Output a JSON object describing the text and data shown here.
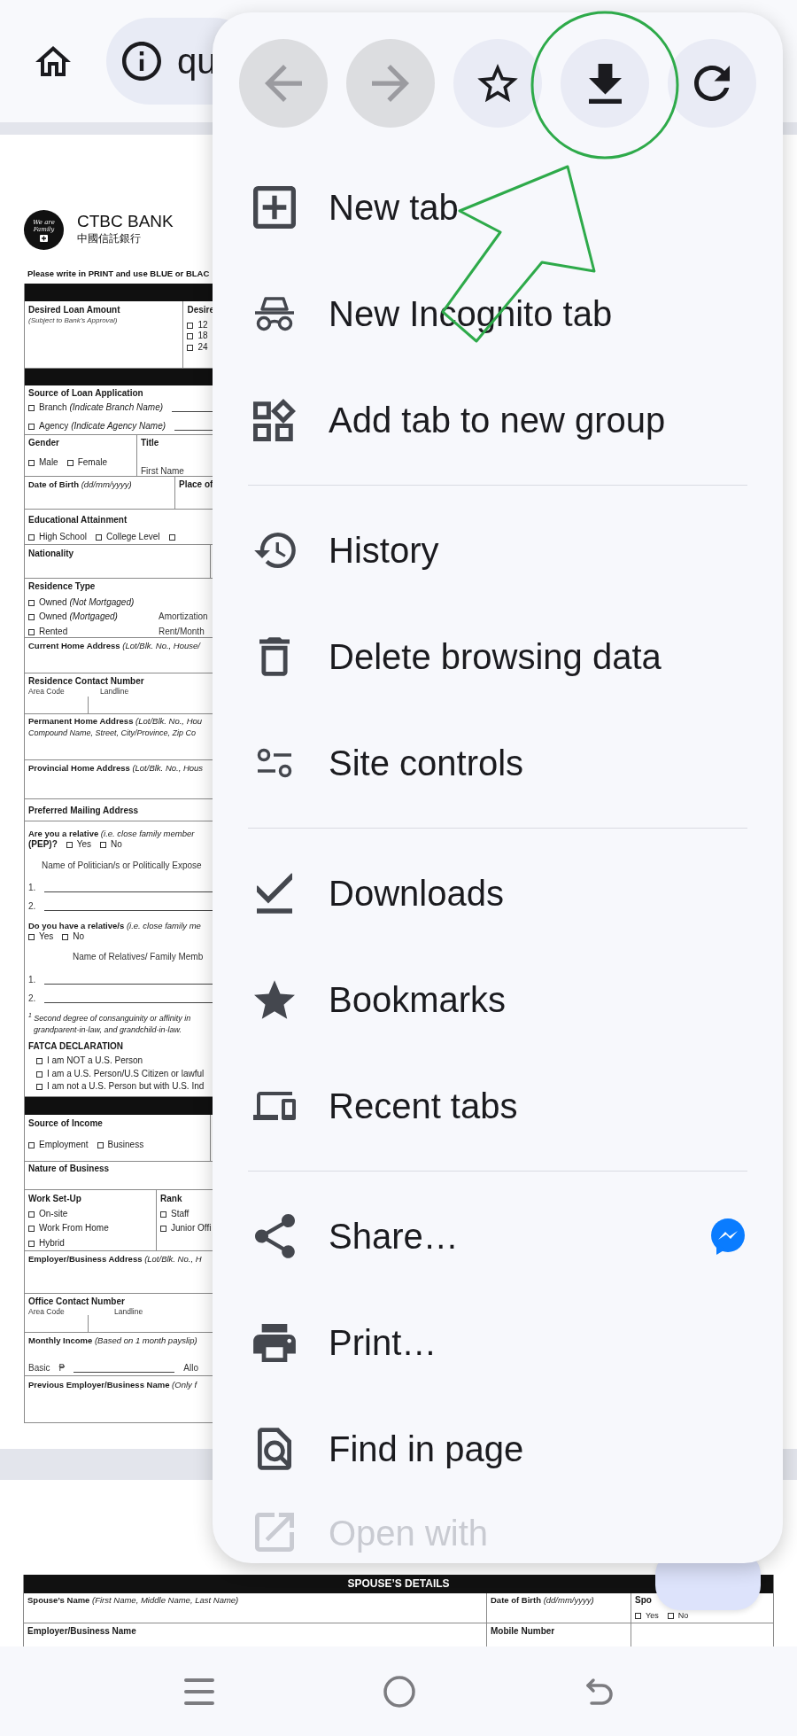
{
  "top_bar": {
    "url": "qu"
  },
  "document": {
    "logo_text": "We are Family",
    "bank_name": "CTBC BANK",
    "bank_name_chinese": "中國信託銀行",
    "instruction": "Please write in PRINT and use BLUE or BLAC",
    "form_rows": [
      {
        "kind": "bar"
      },
      {
        "kind": "row",
        "cells": [
          {
            "lines": [
              [
                {
                  "kind": "label",
                  "text": "Desired Loan Amount"
                }
              ],
              [
                {
                  "kind": "fine",
                  "text": "(Subject to Bank’s Approval)"
                }
              ]
            ]
          },
          {
            "lines": [
              [
                {
                  "kind": "label",
                  "text": "Desire"
                }
              ],
              [
                {
                  "kind": "check",
                  "text": "12",
                  "checked": false
                }
              ],
              [
                {
                  "kind": "check",
                  "text": "18",
                  "checked": false
                }
              ],
              [
                {
                  "kind": "check",
                  "text": "24",
                  "checked": false
                }
              ]
            ]
          }
        ]
      },
      {
        "kind": "bar"
      },
      {
        "kind": "row",
        "cells": [
          {
            "lines": [
              [
                {
                  "kind": "label",
                  "text": "Source of Loan Application"
                }
              ],
              [
                {
                  "kind": "check",
                  "text": "Branch *(Indicate Branch Name)*",
                  "checked": false
                },
                {
                  "kind": "blank"
                }
              ],
              [
                {
                  "kind": "check",
                  "text": "Agency *(Indicate Agency Name)*",
                  "checked": false
                },
                {
                  "kind": "blank"
                }
              ]
            ]
          }
        ]
      },
      {
        "kind": "row",
        "cells": [
          {
            "lines": [
              [
                {
                  "kind": "label",
                  "text": "Gender"
                }
              ],
              [
                {
                  "kind": "check",
                  "text": "Male",
                  "checked": false
                },
                {
                  "kind": "check",
                  "text": "Female",
                  "checked": false
                }
              ]
            ]
          },
          {
            "lines": [
              [
                {
                  "kind": "label",
                  "text": "Title"
                }
              ],
              [
                {
                  "kind": "text",
                  "text": "First Name"
                }
              ]
            ]
          }
        ]
      },
      {
        "kind": "row",
        "cells": [
          {
            "lines": [
              [
                {
                  "kind": "mixed",
                  "text": "**Date of Birth** *(dd/mm/yyyy)*"
                }
              ]
            ]
          },
          {
            "lines": [
              [
                {
                  "kind": "label",
                  "text": "Place of"
                }
              ]
            ]
          }
        ]
      },
      {
        "kind": "row",
        "cells": [
          {
            "lines": [
              [
                {
                  "kind": "label",
                  "text": "Educational Attainment"
                }
              ],
              [
                {
                  "kind": "check",
                  "text": "High School",
                  "checked": false
                },
                {
                  "kind": "check",
                  "text": "College Level",
                  "checked": false
                },
                {
                  "kind": "check",
                  "checked": false
                }
              ]
            ]
          }
        ]
      },
      {
        "kind": "row",
        "cells": [
          {
            "lines": [
              [
                {
                  "kind": "label",
                  "text": "Nationality"
                }
              ]
            ]
          },
          {}
        ]
      },
      {
        "kind": "row",
        "cells": [
          {
            "lines": [
              [
                {
                  "kind": "label",
                  "text": "Residence Type"
                }
              ],
              [
                {
                  "kind": "check",
                  "text": "Owned *(Not Mortgaged)*",
                  "checked": false
                }
              ],
              [
                {
                  "kind": "check",
                  "text": "Owned *(Mortgaged)*",
                  "checked": false
                },
                {
                  "kind": "aside",
                  "text": "Amortization"
                }
              ],
              [
                {
                  "kind": "check",
                  "text": "Rented",
                  "checked": false
                },
                {
                  "kind": "aside",
                  "text": "Rent/Month"
                }
              ]
            ]
          }
        ]
      },
      {
        "kind": "row",
        "cells": [
          {
            "lines": [
              [
                {
                  "kind": "mixed",
                  "text": "**Current Home Address** *(Lot/Blk. No., House/*"
                }
              ]
            ]
          }
        ]
      },
      {
        "kind": "row",
        "cells": [
          {
            "lines": [
              [
                {
                  "kind": "label",
                  "text": "Residence Contact Number"
                }
              ],
              [
                {
                  "kind": "sub",
                  "text": "Area Code"
                },
                {
                  "kind": "sub",
                  "text": "Landline"
                }
              ]
            ]
          }
        ]
      },
      {
        "kind": "row",
        "cells": [
          {
            "lines": [
              [
                {
                  "kind": "mixed",
                  "text": "**Permanent Home Address** *(Lot/Blk. No., Hou*"
                }
              ],
              [
                {
                  "kind": "note",
                  "text": "Compound Name, Street, City/Province, Zip Co"
                }
              ]
            ]
          }
        ]
      },
      {
        "kind": "row",
        "cells": [
          {
            "lines": [
              [
                {
                  "kind": "mixed",
                  "text": "**Provincial Home Address** *(Lot/Blk. No., Hous*"
                }
              ]
            ]
          }
        ]
      },
      {
        "kind": "row",
        "cells": [
          {
            "lines": [
              [
                {
                  "kind": "label",
                  "text": "Preferred Mailing Address"
                }
              ]
            ]
          }
        ]
      },
      {
        "kind": "row",
        "cells": [
          {
            "lines": [
              [
                {
                  "kind": "mixed",
                  "text": "**Are you a relative** *(i.e. close family member*"
                }
              ],
              [
                {
                  "kind": "label",
                  "text": "(PEP)?"
                },
                {
                  "kind": "check",
                  "text": "Yes",
                  "checked": false
                },
                {
                  "kind": "check",
                  "text": "No",
                  "checked": false
                }
              ],
              [
                {
                  "kind": "text",
                  "text": "Name of Politician/s or Politically Expose"
                }
              ],
              [
                {
                  "kind": "text",
                  "text": "1."
                },
                {
                  "kind": "blank"
                }
              ],
              [
                {
                  "kind": "text",
                  "text": "2."
                },
                {
                  "kind": "blank"
                }
              ],
              [
                {
                  "kind": "mixed",
                  "text": "**Do you have a relative/s** *(i.e. close family me*"
                }
              ],
              [
                {
                  "kind": "check",
                  "text": "Yes",
                  "checked": false
                },
                {
                  "kind": "check",
                  "text": "No",
                  "checked": false
                }
              ],
              [
                {
                  "kind": "text",
                  "text": "Name of Relatives/ Family Memb"
                }
              ],
              [
                {
                  "kind": "text",
                  "text": "1."
                },
                {
                  "kind": "blank"
                }
              ],
              [
                {
                  "kind": "text",
                  "text": "2."
                },
                {
                  "kind": "blank"
                }
              ],
              [
                {
                  "kind": "note",
                  "text": "$^{1}$ Second degree of consanguinity or affinity in"
                }
              ],
              [
                {
                  "kind": "note",
                  "text": "grandparent-in-law, and grandchild-in-law."
                }
              ],
              [
                {
                  "kind": "label",
                  "text": "FATCA DECLARATION"
                }
              ],
              [
                {
                  "kind": "check",
                  "text": "I am NOT a U.S. Person",
                  "checked": false
                }
              ],
              [
                {
                  "kind": "check",
                  "text": "I am a U.S. Person/U.S Citizen or lawful",
                  "checked": false
                }
              ],
              [
                {
                  "kind": "check",
                  "text": "I am not a U.S. Person but with U.S. Ind",
                  "checked": false
                }
              ]
            ]
          }
        ]
      },
      {
        "kind": "bar"
      },
      {
        "kind": "row",
        "cells": [
          {
            "lines": [
              [
                {
                  "kind": "label",
                  "text": "Source of Income"
                }
              ],
              [
                {
                  "kind": "check",
                  "text": "Employment",
                  "checked": false
                },
                {
                  "kind": "check",
                  "text": "Business",
                  "checked": false
                }
              ]
            ]
          },
          {}
        ]
      },
      {
        "kind": "row",
        "cells": [
          {
            "lines": [
              [
                {
                  "kind": "label",
                  "text": "Nature of Business"
                }
              ]
            ]
          }
        ]
      },
      {
        "kind": "row",
        "cells": [
          {
            "lines": [
              [
                {
                  "kind": "label",
                  "text": "Work Set-Up"
                }
              ],
              [
                {
                  "kind": "check",
                  "text": "On-site",
                  "checked": false
                }
              ],
              [
                {
                  "kind": "check",
                  "text": "Work From Home",
                  "checked": false
                }
              ],
              [
                {
                  "kind": "check",
                  "text": "Hybrid",
                  "checked": false
                }
              ]
            ]
          },
          {
            "lines": [
              [
                {
                  "kind": "label",
                  "text": "Rank"
                }
              ],
              [
                {
                  "kind": "check",
                  "text": "Staff",
                  "checked": false
                }
              ],
              [
                {
                  "kind": "check",
                  "text": "Junior Offi",
                  "checked": false
                }
              ]
            ]
          }
        ]
      },
      {
        "kind": "row",
        "cells": [
          {
            "lines": [
              [
                {
                  "kind": "mixed",
                  "text": "**Employer/Business Address** *(Lot/Blk. No., H*"
                }
              ]
            ]
          }
        ]
      },
      {
        "kind": "row",
        "cells": [
          {
            "lines": [
              [
                {
                  "kind": "label",
                  "text": "Office Contact Number"
                }
              ],
              [
                {
                  "kind": "sub",
                  "text": "Area Code"
                },
                {
                  "kind": "sub",
                  "text": "Landline"
                }
              ]
            ]
          }
        ]
      },
      {
        "kind": "row",
        "cells": [
          {
            "lines": [
              [
                {
                  "kind": "mixed",
                  "text": "**Monthly Income** *(Based on 1 month payslip)*"
                }
              ],
              [
                {
                  "kind": "text",
                  "text": "Basic"
                },
                {
                  "kind": "text",
                  "text": "₱"
                },
                {
                  "kind": "blank"
                },
                {
                  "kind": "text",
                  "text": "Allo"
                }
              ]
            ]
          }
        ]
      },
      {
        "kind": "row",
        "cells": [
          {
            "lines": [
              [
                {
                  "kind": "mixed",
                  "text": "**Previous Employer/Business Name** *(Only f*"
                }
              ]
            ]
          }
        ]
      }
    ],
    "spouse_table": {
      "title": "SPOUSE’S DETAILS",
      "rows": [
        {
          "kind": "row",
          "cells": [
            {
              "lines": [
                [
                  {
                    "kind": "mixed",
                    "text": "**Spouse’s Name** *(First Name, Middle Name, Last Name)*"
                  }
                ]
              ]
            },
            {
              "lines": [
                [
                  {
                    "kind": "mixed",
                    "text": "**Date of Birth** *(dd/mm/yyyy)*"
                  }
                ]
              ]
            },
            {
              "lines": [
                [
                  {
                    "kind": "label",
                    "text": "Spo"
                  }
                ],
                [
                  {
                    "kind": "check",
                    "text": "Yes",
                    "checked": false
                  },
                  {
                    "kind": "check",
                    "text": "No",
                    "checked": false
                  }
                ]
              ]
            }
          ]
        },
        {
          "kind": "row",
          "cells": [
            {
              "lines": [
                [
                  {
                    "kind": "label",
                    "text": "Employer/Business Name"
                  }
                ]
              ]
            },
            {
              "lines": [
                [
                  {
                    "kind": "label",
                    "text": "Mobile Number"
                  }
                ]
              ]
            },
            {}
          ]
        }
      ]
    }
  },
  "menu": {
    "toolbar": [
      {
        "kind": "back",
        "disabled": true
      },
      {
        "kind": "forward",
        "disabled": true
      },
      {
        "kind": "bookmark",
        "disabled": false
      },
      {
        "kind": "download",
        "disabled": false
      },
      {
        "kind": "refresh",
        "disabled": false
      }
    ],
    "sections": [
      [
        {
          "label": "New tab",
          "faded": false
        },
        {
          "label": "New Incognito tab",
          "faded": false
        },
        {
          "label": "Add tab to new group",
          "faded": false
        }
      ],
      [
        {
          "label": "History",
          "faded": false
        },
        {
          "label": "Delete browsing data",
          "faded": false
        },
        {
          "label": "Site controls",
          "faded": false
        }
      ],
      [
        {
          "label": "Downloads",
          "faded": false
        },
        {
          "label": "Bookmarks",
          "faded": false
        },
        {
          "label": "Recent tabs",
          "faded": false
        }
      ],
      [
        {
          "label": "Share…",
          "faded": false
        },
        {
          "label": "Print…",
          "faded": false
        },
        {
          "label": "Find in page",
          "faded": false
        },
        {
          "label": "Open with",
          "faded": true
        }
      ]
    ]
  }
}
